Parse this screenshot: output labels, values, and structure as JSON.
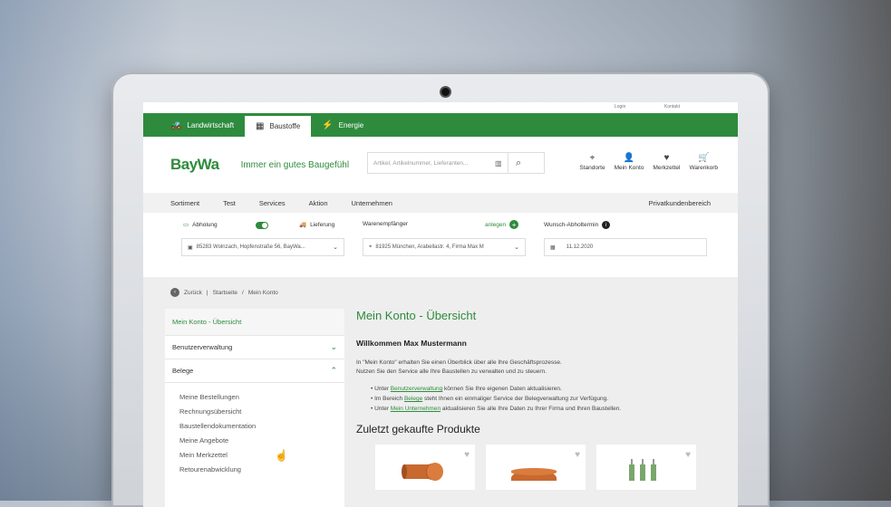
{
  "topbar": {
    "links": [
      "Login",
      "Kontakt"
    ]
  },
  "categories": [
    {
      "label": "Landwirtschaft",
      "icon": "tractor-icon",
      "active": false
    },
    {
      "label": "Baustoffe",
      "icon": "building-materials-icon",
      "active": true
    },
    {
      "label": "Energie",
      "icon": "energy-icon",
      "active": false
    }
  ],
  "header": {
    "logo": "BayWa",
    "tagline": "Immer ein gutes Baugefühl",
    "search_placeholder": "Artikel, Artikelnummer, Lieferanten...",
    "icons": [
      {
        "label": "Standorte",
        "icon": "location-pin-icon"
      },
      {
        "label": "Mein Konto",
        "icon": "user-icon"
      },
      {
        "label": "Merkzettel",
        "icon": "heart-icon"
      },
      {
        "label": "Warenkorb",
        "icon": "cart-icon"
      }
    ]
  },
  "mainnav": {
    "items": [
      "Sortiment",
      "Test",
      "Services",
      "Aktion",
      "Unternehmen"
    ],
    "right": "Privatkundenbereich"
  },
  "pickup": {
    "abholung": "Abholung",
    "lieferung": "Lieferung",
    "branch": "85283 Wolnzach, Hopfenstraße 56, BayWa...",
    "recipient_label": "Warenempfänger",
    "recipient_add": "anlegen",
    "recipient_value": "81925 München, Arabellastr. 4, Firma Max M",
    "date_label": "Wunsch-Abholtermin",
    "date_value": "11.12.2020"
  },
  "breadcrumb": {
    "back": "Zurück",
    "items": [
      "Startseite",
      "Mein Konto"
    ]
  },
  "sidebar": {
    "items": [
      {
        "label": "Mein Konto - Übersicht",
        "active": true
      },
      {
        "label": "Benutzerverwaltung",
        "expanded": false
      },
      {
        "label": "Belege",
        "expanded": true
      }
    ],
    "sub": [
      "Meine Bestellungen",
      "Rechnungsübersicht",
      "Baustellendokumentation",
      "Meine Angebote",
      "Mein Merkzettel",
      "Retourenabwicklung"
    ]
  },
  "content": {
    "title": "Mein Konto - Übersicht",
    "welcome": "Willkommen Max Mustermann",
    "intro1": "In \"Mein Konto\" erhalten Sie einen Überblick über alle Ihre Geschäftsprozesse.",
    "intro2": "Nutzen Sie den Service alle Ihre Baustellen zu verwalten und zu steuern.",
    "b1_pre": "Unter ",
    "b1_link": "Benutzerverwaltung",
    "b1_post": " können Sie Ihre eigenen Daten aktualisieren.",
    "b2_pre": "Im Bereich ",
    "b2_link": "Belege",
    "b2_post": " steht Ihnen ein einmaliger Service der Belegverwaltung zur Verfügung.",
    "b3_pre": "Unter ",
    "b3_link": "Mein Unternehmen",
    "b3_post": " aktualisieren Sie alle Ihre Daten zu Ihrer Firma und Ihren Baustellen.",
    "recent_title": "Zuletzt gekaufte Produkte"
  },
  "colors": {
    "brand": "#2e8b3d"
  }
}
